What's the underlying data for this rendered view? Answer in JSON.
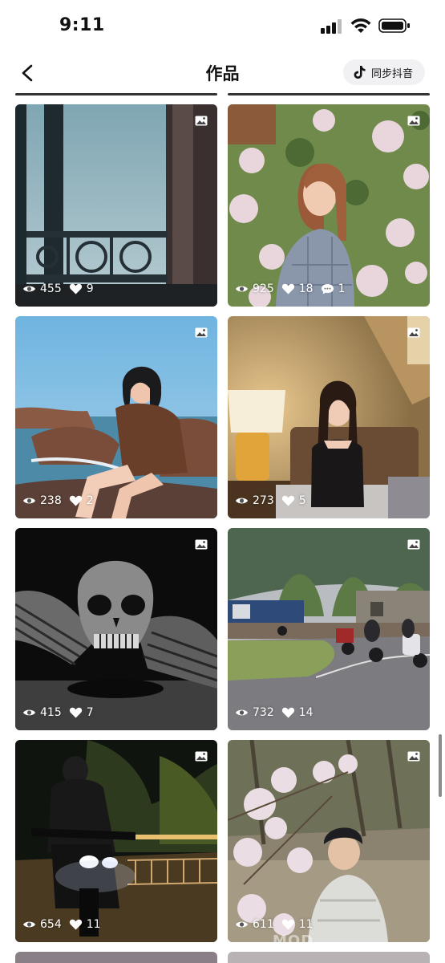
{
  "status_bar": {
    "time": "9:11"
  },
  "nav": {
    "title": "作品",
    "sync_label": "同步抖音"
  },
  "works": [
    {
      "views": "455",
      "likes": "9",
      "comments": ""
    },
    {
      "views": "925",
      "likes": "18",
      "comments": "1"
    },
    {
      "views": "238",
      "likes": "2",
      "comments": ""
    },
    {
      "views": "273",
      "likes": "5",
      "comments": ""
    },
    {
      "views": "415",
      "likes": "7",
      "comments": ""
    },
    {
      "views": "732",
      "likes": "14",
      "comments": ""
    },
    {
      "views": "654",
      "likes": "11",
      "comments": ""
    },
    {
      "views": "611",
      "likes": "11",
      "comments": ""
    }
  ],
  "watermark": "MOD"
}
